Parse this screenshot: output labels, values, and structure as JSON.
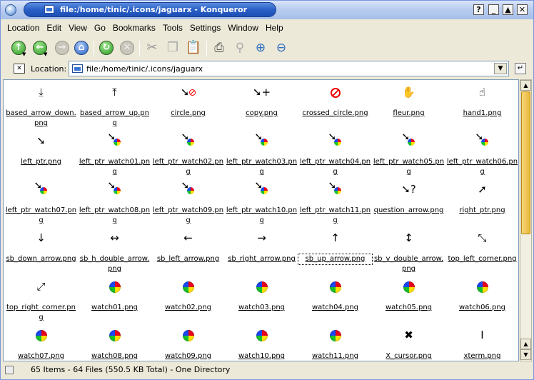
{
  "window": {
    "title": "file:/home/tinic/.icons/jaguarx - Konqueror",
    "buttons": [
      "?",
      "_",
      "▲",
      "✕"
    ]
  },
  "menu": [
    "Location",
    "Edit",
    "View",
    "Go",
    "Bookmarks",
    "Tools",
    "Settings",
    "Window",
    "Help"
  ],
  "toolbar": {
    "items": [
      "up-arrow-icon",
      "back-arrow-icon",
      "forward-arrow-icon",
      "home-icon",
      "reload-icon",
      "stop-icon",
      "cut-icon",
      "copy-icon",
      "paste-icon",
      "print-icon",
      "find-icon",
      "zoom-in-icon",
      "zoom-out-icon"
    ]
  },
  "location": {
    "label": "Location:",
    "value": "file:/home/tinic/.icons/jaguarx"
  },
  "files": [
    {
      "name": "based_arrow_down.png",
      "glyph": "⤓",
      "kind": "text"
    },
    {
      "name": "based_arrow_up.png",
      "glyph": "⤒",
      "kind": "text"
    },
    {
      "name": "circle.png",
      "glyph": "➘",
      "kind": "ptr-red"
    },
    {
      "name": "copy.png",
      "glyph": "➘",
      "kind": "ptr-plus"
    },
    {
      "name": "crossed_circle.png",
      "glyph": "",
      "kind": "red"
    },
    {
      "name": "fleur.png",
      "glyph": "✋",
      "kind": "text"
    },
    {
      "name": "hand1.png",
      "glyph": "☝",
      "kind": "text"
    },
    {
      "name": "left_ptr.png",
      "glyph": "➘",
      "kind": "text"
    },
    {
      "name": "left_ptr_watch01.png",
      "glyph": "➘",
      "kind": "ptrw"
    },
    {
      "name": "left_ptr_watch02.png",
      "glyph": "➘",
      "kind": "ptrw"
    },
    {
      "name": "left_ptr_watch03.png",
      "glyph": "➘",
      "kind": "ptrw"
    },
    {
      "name": "left_ptr_watch04.png",
      "glyph": "➘",
      "kind": "ptrw"
    },
    {
      "name": "left_ptr_watch05.png",
      "glyph": "➘",
      "kind": "ptrw"
    },
    {
      "name": "left_ptr_watch06.png",
      "glyph": "➘",
      "kind": "ptrw"
    },
    {
      "name": "left_ptr_watch07.png",
      "glyph": "➘",
      "kind": "ptrw"
    },
    {
      "name": "left_ptr_watch08.png",
      "glyph": "➘",
      "kind": "ptrw"
    },
    {
      "name": "left_ptr_watch09.png",
      "glyph": "➘",
      "kind": "ptrw"
    },
    {
      "name": "left_ptr_watch10.png",
      "glyph": "➘",
      "kind": "ptrw"
    },
    {
      "name": "left_ptr_watch11.png",
      "glyph": "➘",
      "kind": "ptrw"
    },
    {
      "name": "question_arrow.png",
      "glyph": "➘?",
      "kind": "text"
    },
    {
      "name": "right_ptr.png",
      "glyph": "➚",
      "kind": "text"
    },
    {
      "name": "sb_down_arrow.png",
      "glyph": "↓",
      "kind": "text"
    },
    {
      "name": "sb_h_double_arrow.png",
      "glyph": "↔",
      "kind": "text"
    },
    {
      "name": "sb_left_arrow.png",
      "glyph": "←",
      "kind": "text"
    },
    {
      "name": "sb_right_arrow.png",
      "glyph": "→",
      "kind": "text"
    },
    {
      "name": "sb_up_arrow.png",
      "glyph": "↑",
      "kind": "text",
      "selected": true
    },
    {
      "name": "sb_v_double_arrow.png",
      "glyph": "↕",
      "kind": "text"
    },
    {
      "name": "top_left_corner.png",
      "glyph": "⤡",
      "kind": "text"
    },
    {
      "name": "top_right_corner.png",
      "glyph": "⤢",
      "kind": "text"
    },
    {
      "name": "watch01.png",
      "glyph": "",
      "kind": "wheel"
    },
    {
      "name": "watch02.png",
      "glyph": "",
      "kind": "wheel"
    },
    {
      "name": "watch03.png",
      "glyph": "",
      "kind": "wheel"
    },
    {
      "name": "watch04.png",
      "glyph": "",
      "kind": "wheel"
    },
    {
      "name": "watch05.png",
      "glyph": "",
      "kind": "wheel"
    },
    {
      "name": "watch06.png",
      "glyph": "",
      "kind": "wheel"
    },
    {
      "name": "watch07.png",
      "glyph": "",
      "kind": "wheel"
    },
    {
      "name": "watch08.png",
      "glyph": "",
      "kind": "wheel"
    },
    {
      "name": "watch09.png",
      "glyph": "",
      "kind": "wheel"
    },
    {
      "name": "watch10.png",
      "glyph": "",
      "kind": "wheel"
    },
    {
      "name": "watch11.png",
      "glyph": "",
      "kind": "wheel"
    },
    {
      "name": "X_cursor.png",
      "glyph": "✖",
      "kind": "text"
    },
    {
      "name": "xterm.png",
      "glyph": "I",
      "kind": "text"
    }
  ],
  "status": {
    "text": "65 Items - 64 Files (550.5 KB Total) - One Directory"
  }
}
